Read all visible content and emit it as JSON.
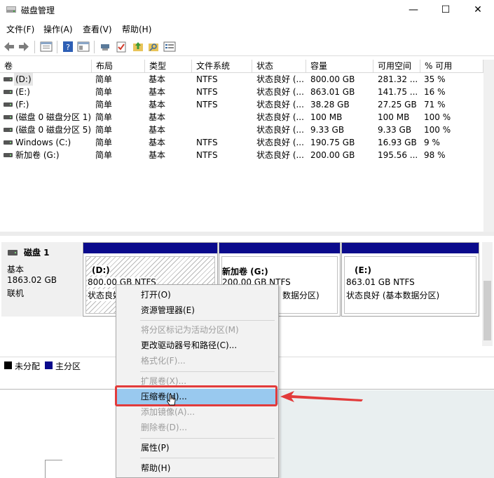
{
  "window": {
    "title": "磁盘管理"
  },
  "titlebar_controls": {
    "minimize": "—",
    "maximize": "☐",
    "close": "✕"
  },
  "menu": [
    "文件(F)",
    "操作(A)",
    "查看(V)",
    "帮助(H)"
  ],
  "table": {
    "columns": [
      "卷",
      "布局",
      "类型",
      "文件系统",
      "状态",
      "容量",
      "可用空间",
      "% 可用"
    ],
    "rows": [
      [
        "(D:)",
        "简单",
        "基本",
        "NTFS",
        "状态良好 (...",
        "800.00 GB",
        "281.32 ...",
        "35 %"
      ],
      [
        "(E:)",
        "简单",
        "基本",
        "NTFS",
        "状态良好 (...",
        "863.01 GB",
        "141.75 ...",
        "16 %"
      ],
      [
        "(F:)",
        "简单",
        "基本",
        "NTFS",
        "状态良好 (...",
        "38.28 GB",
        "27.25 GB",
        "71 %"
      ],
      [
        "(磁盘 0 磁盘分区 1)",
        "简单",
        "基本",
        "",
        "状态良好 (...",
        "100 MB",
        "100 MB",
        "100 %"
      ],
      [
        "(磁盘 0 磁盘分区 5)",
        "简单",
        "基本",
        "",
        "状态良好 (...",
        "9.33 GB",
        "9.33 GB",
        "100 %"
      ],
      [
        "Windows (C:)",
        "简单",
        "基本",
        "NTFS",
        "状态良好 (...",
        "190.75 GB",
        "16.93 GB",
        "9 %"
      ],
      [
        "新加卷 (G:)",
        "简单",
        "基本",
        "NTFS",
        "状态良好 (...",
        "200.00 GB",
        "195.56 ...",
        "98 %"
      ]
    ]
  },
  "disk": {
    "name": "磁盘 1",
    "type": "基本",
    "size": "1863.02 GB",
    "status": "联机"
  },
  "partitions": [
    {
      "label": "(D:)",
      "size": "800.00 GB NTFS",
      "status": "状态良好"
    },
    {
      "label": "新加卷  (G:)",
      "size": "200.00 GB NTFS",
      "status": "状态良好 (基本数据分区)"
    },
    {
      "label": "(E:)",
      "size": "863.01 GB NTFS",
      "status": "状态良好 (基本数据分区)"
    }
  ],
  "partition_status_visible": {
    "g": "数据分区)"
  },
  "legend": {
    "unallocated": "未分配",
    "primary": "主分区"
  },
  "context_menu": {
    "open": "打开(O)",
    "explorer": "资源管理器(E)",
    "mark_active": "将分区标记为活动分区(M)",
    "change_letter": "更改驱动器号和路径(C)...",
    "format": "格式化(F)...",
    "extend": "扩展卷(X)...",
    "shrink": "压缩卷(H)...",
    "mirror": "添加镜像(A)...",
    "delete": "删除卷(D)...",
    "properties": "属性(P)",
    "help": "帮助(H)"
  },
  "colors": {
    "primary_partition": "#0a0a8c",
    "highlight": "#e23b3b",
    "menu_selected": "#99c9ef"
  }
}
